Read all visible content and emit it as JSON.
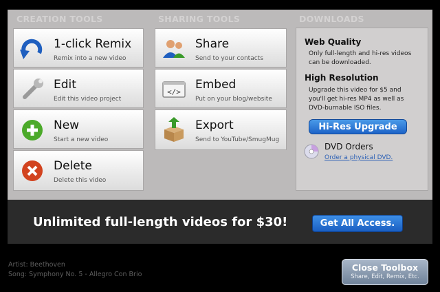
{
  "sections": {
    "creation": "CREATION TOOLS",
    "sharing": "SHARING TOOLS",
    "downloads": "DOWNLOADS"
  },
  "creation_tools": [
    {
      "title": "1-click Remix",
      "subtitle": "Remix into a new video",
      "icon": "remix-arrow-icon"
    },
    {
      "title": "Edit",
      "subtitle": "Edit this video project",
      "icon": "wrench-icon"
    },
    {
      "title": "New",
      "subtitle": "Start a new video",
      "icon": "plus-icon"
    },
    {
      "title": "Delete",
      "subtitle": "Delete this video",
      "icon": "delete-x-icon"
    }
  ],
  "sharing_tools": [
    {
      "title": "Share",
      "subtitle": "Send to your contacts",
      "icon": "contacts-icon"
    },
    {
      "title": "Embed",
      "subtitle": "Put on your blog/website",
      "icon": "embed-code-icon"
    },
    {
      "title": "Export",
      "subtitle": "Send to YouTube/SmugMug",
      "icon": "export-box-icon"
    }
  ],
  "downloads": {
    "web_quality_title": "Web Quality",
    "web_quality_line1": "Only full-length and hi-res videos",
    "web_quality_line2": "can be downloaded.",
    "high_res_title": "High Resolution",
    "high_res_line1": "Upgrade this video for $5 and",
    "high_res_line2": "you'll get hi-res MP4 as well as",
    "high_res_line3": "DVD-burnable ISO files.",
    "upgrade_button": "Hi-Res Upgrade",
    "dvd_title": "DVD Orders",
    "dvd_link": "Order a physical DVD."
  },
  "promo": {
    "text": "Unlimited full-length videos for $30!",
    "button": "Get All Access."
  },
  "footer": {
    "artist": "Artist: Beethoven",
    "song": "Song: Symphony No. 5 - Allegro Con Brio"
  },
  "close_button": {
    "label": "Close Toolbox",
    "sublabel": "Share, Edit, Remix, Etc."
  }
}
